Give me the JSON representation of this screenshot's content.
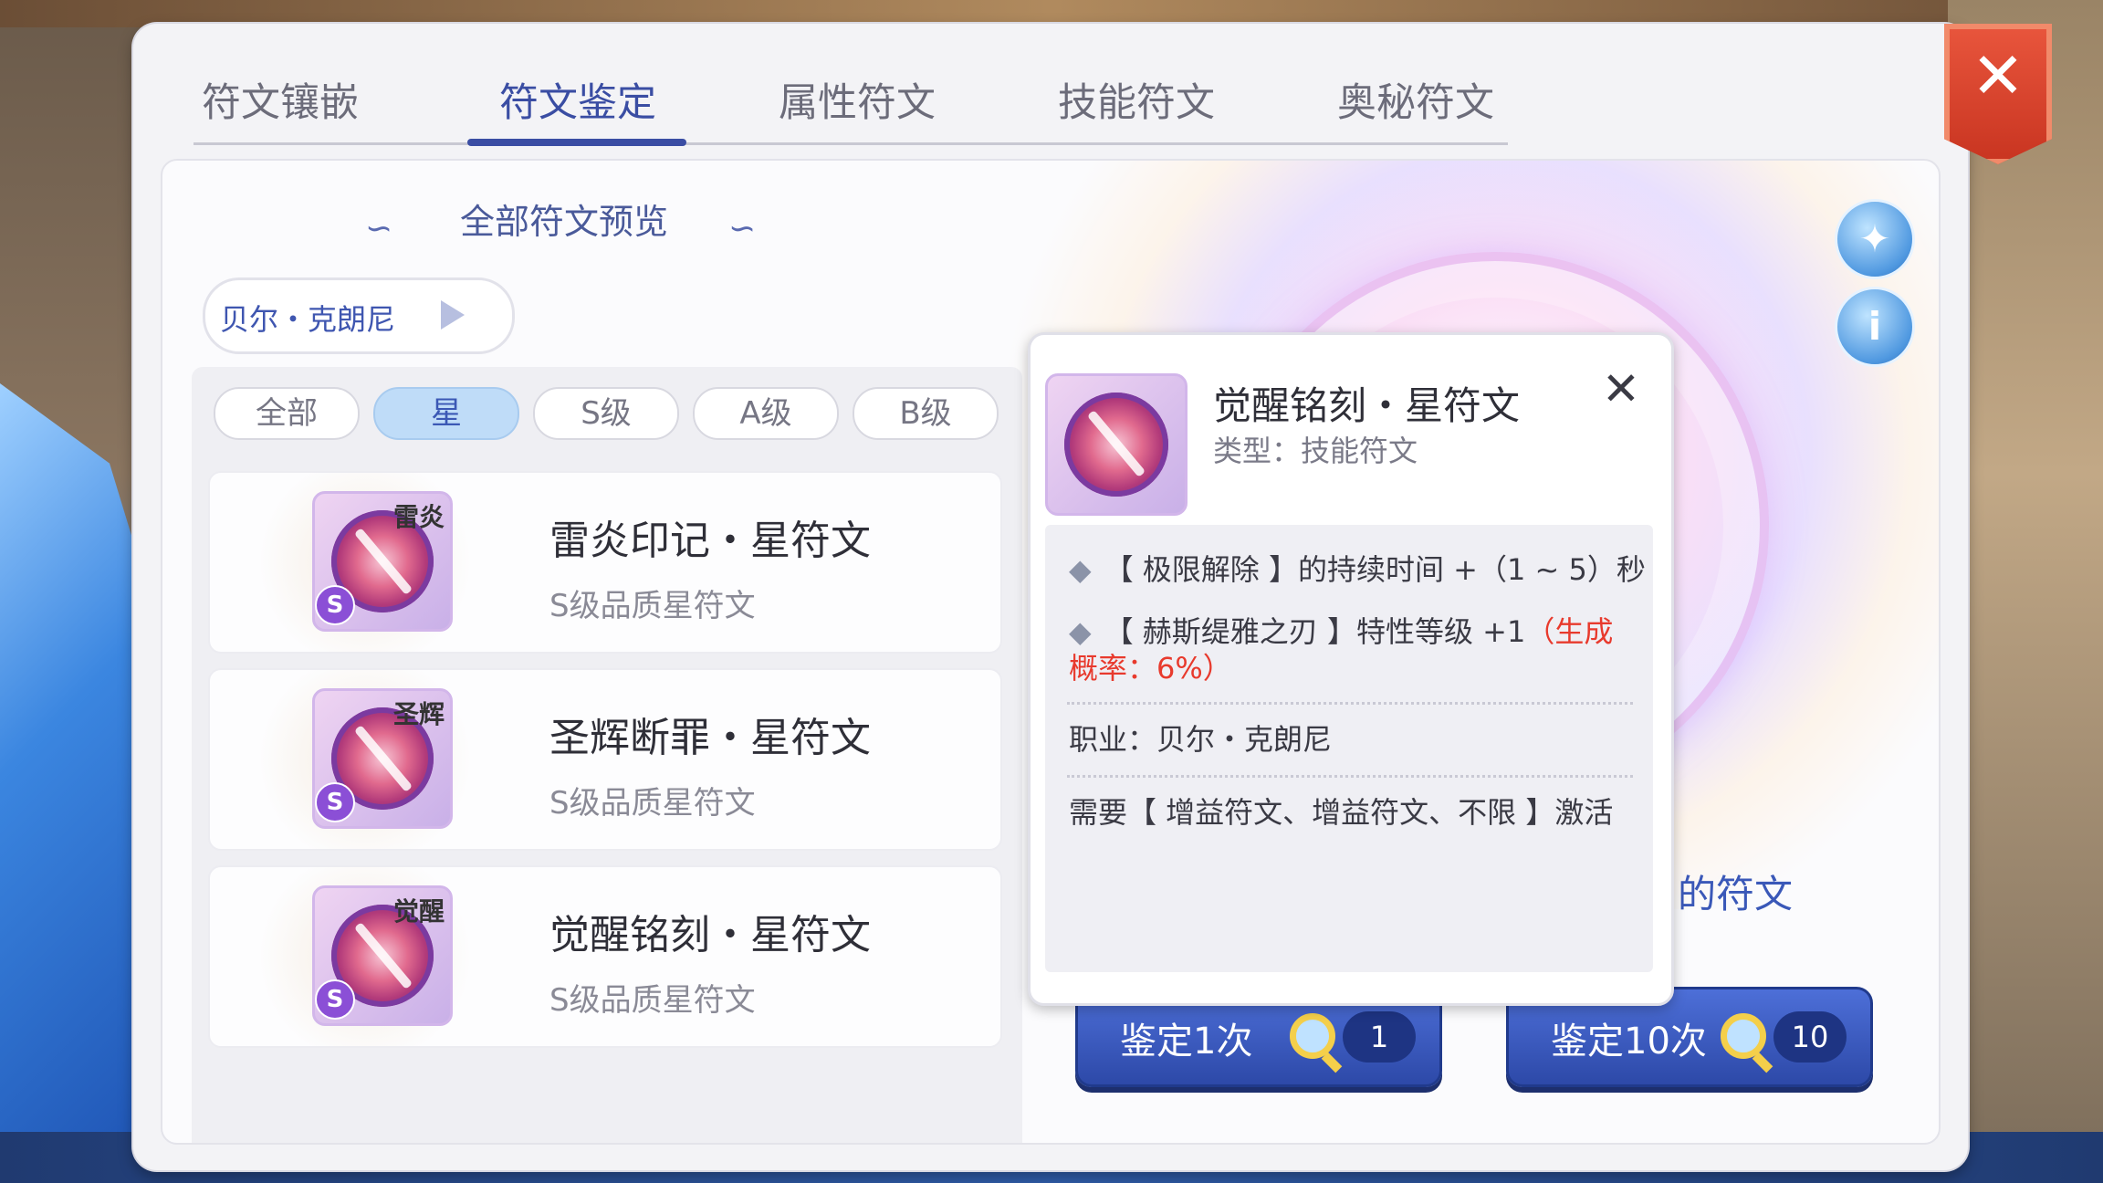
{
  "tabs": [
    "符文镶嵌",
    "符文鉴定",
    "属性符文",
    "技能符文",
    "奥秘符文"
  ],
  "close_label": "✕",
  "preview": {
    "title": "全部符文预览",
    "class_name": "贝尔・克朗尼"
  },
  "filters": [
    "全部",
    "星",
    "S级",
    "A级",
    "B级"
  ],
  "runes": [
    {
      "tag": "雷炎",
      "grade": "S",
      "name": "雷炎印记・星符文",
      "sub": "S级品质星符文"
    },
    {
      "tag": "圣辉",
      "grade": "S",
      "name": "圣辉断罪・星符文",
      "sub": "S级品质星符文"
    },
    {
      "tag": "觉醒",
      "grade": "S",
      "name": "觉醒铭刻・星符文",
      "sub": "S级品质星符文"
    }
  ],
  "side_buttons": {
    "magic_icon": "magic-wand-icon",
    "info": "i"
  },
  "appraise": {
    "once_label": "鉴定1次",
    "once_count": "1",
    "ten_label": "鉴定10次",
    "ten_count": "10",
    "partial_text": "的符文"
  },
  "popup": {
    "title": "觉醒铭刻・星符文",
    "type": "类型：技能符文",
    "close": "✕",
    "effect1": "【 极限解除 】的持续时间 +（1 ~ 5）秒",
    "effect2_a": "【 赫斯缇雅之刃 】特性等级 +1",
    "effect2_b": "（生成",
    "effect2_c": "概率：6%）",
    "job": "职业：贝尔・克朗尼",
    "requirement": "需要【 增益符文、增益符文、不限 】激活"
  },
  "colors": {
    "accent": "#3a4da3",
    "close_red": "#d9432b",
    "highlight_red": "#e83a2d"
  }
}
